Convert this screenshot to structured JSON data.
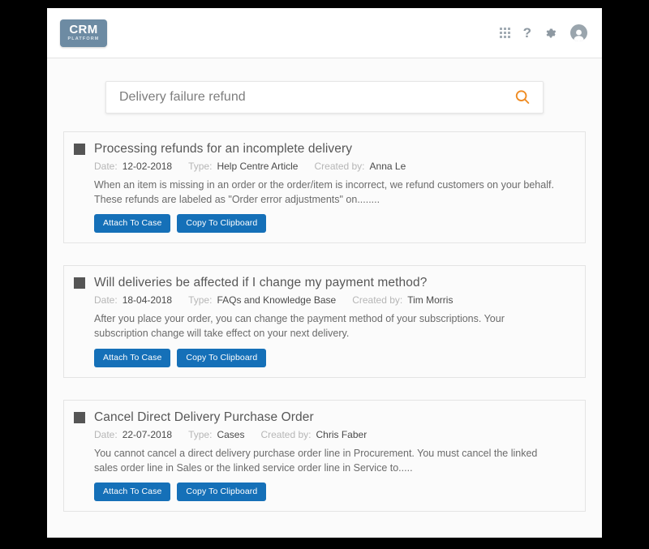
{
  "window": {
    "logo": {
      "main": "CRM",
      "sub": "PLATFORM"
    }
  },
  "header": {
    "icons": [
      {
        "name": "apps-grid-icon",
        "label": "Apps"
      },
      {
        "name": "help-icon",
        "label": "?"
      },
      {
        "name": "gear-icon",
        "label": "Settings"
      },
      {
        "name": "avatar-icon",
        "label": "Account"
      }
    ]
  },
  "search": {
    "value": "Delivery failure refund",
    "placeholder": "Search",
    "icon": "search-icon",
    "icon_color": "#ef8b22"
  },
  "labels": {
    "date": "Date:",
    "type": "Type:",
    "created_by": "Created by:",
    "attach": "Attach To Case",
    "copy": "Copy To Clipboard"
  },
  "colors": {
    "button_blue": "#1570b8",
    "logo_slate": "#6d8ba3",
    "accent_orange": "#ef8b22",
    "doc_square": "#555555"
  },
  "results": [
    {
      "title": "Processing refunds for an incomplete delivery",
      "date": "12-02-2018",
      "type": "Help Centre Article",
      "created_by": "Anna Le",
      "description": "When an item is missing in an order or the order/item is incorrect, we refund customers on your behalf. These refunds are labeled as \"Order error adjustments\" on........"
    },
    {
      "title": "Will deliveries be affected if I change my payment method?",
      "date": "18-04-2018",
      "type": "FAQs and Knowledge Base",
      "created_by": "Tim Morris",
      "description": "After you place your order, you can change the payment method of your subscriptions. Your subscription change will take effect on your next delivery."
    },
    {
      "title": "Cancel Direct Delivery Purchase Order",
      "date": "22-07-2018",
      "type": "Cases",
      "created_by": "Chris Faber",
      "description": "You cannot cancel a direct delivery purchase order line in Procurement. You must cancel the linked sales order line in Sales or the linked service order line in Service to....."
    }
  ]
}
